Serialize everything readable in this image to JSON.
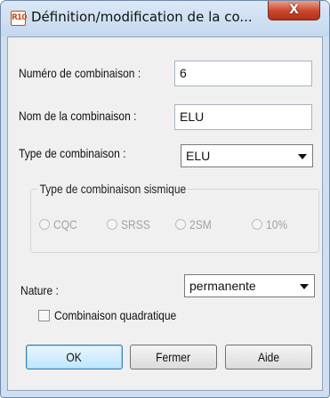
{
  "window": {
    "title": "Définition/modification de la co...",
    "icon_text": "R10",
    "close_glyph": "X"
  },
  "form": {
    "numero_label": "Numéro de combinaison :",
    "numero_value": "6",
    "nom_label": "Nom de la combinaison :",
    "nom_value": "ELU",
    "type_label": "Type de combinaison :",
    "type_value": "ELU",
    "sismique_group_label": "Type de combinaison sismique",
    "sismique_options": [
      "CQC",
      "SRSS",
      "2SM",
      "10%"
    ],
    "nature_label": "Nature :",
    "nature_value": "permanente",
    "quadratique_label": "Combinaison quadratique",
    "quadratique_checked": false
  },
  "buttons": {
    "ok": "OK",
    "fermer": "Fermer",
    "aide": "Aide"
  }
}
